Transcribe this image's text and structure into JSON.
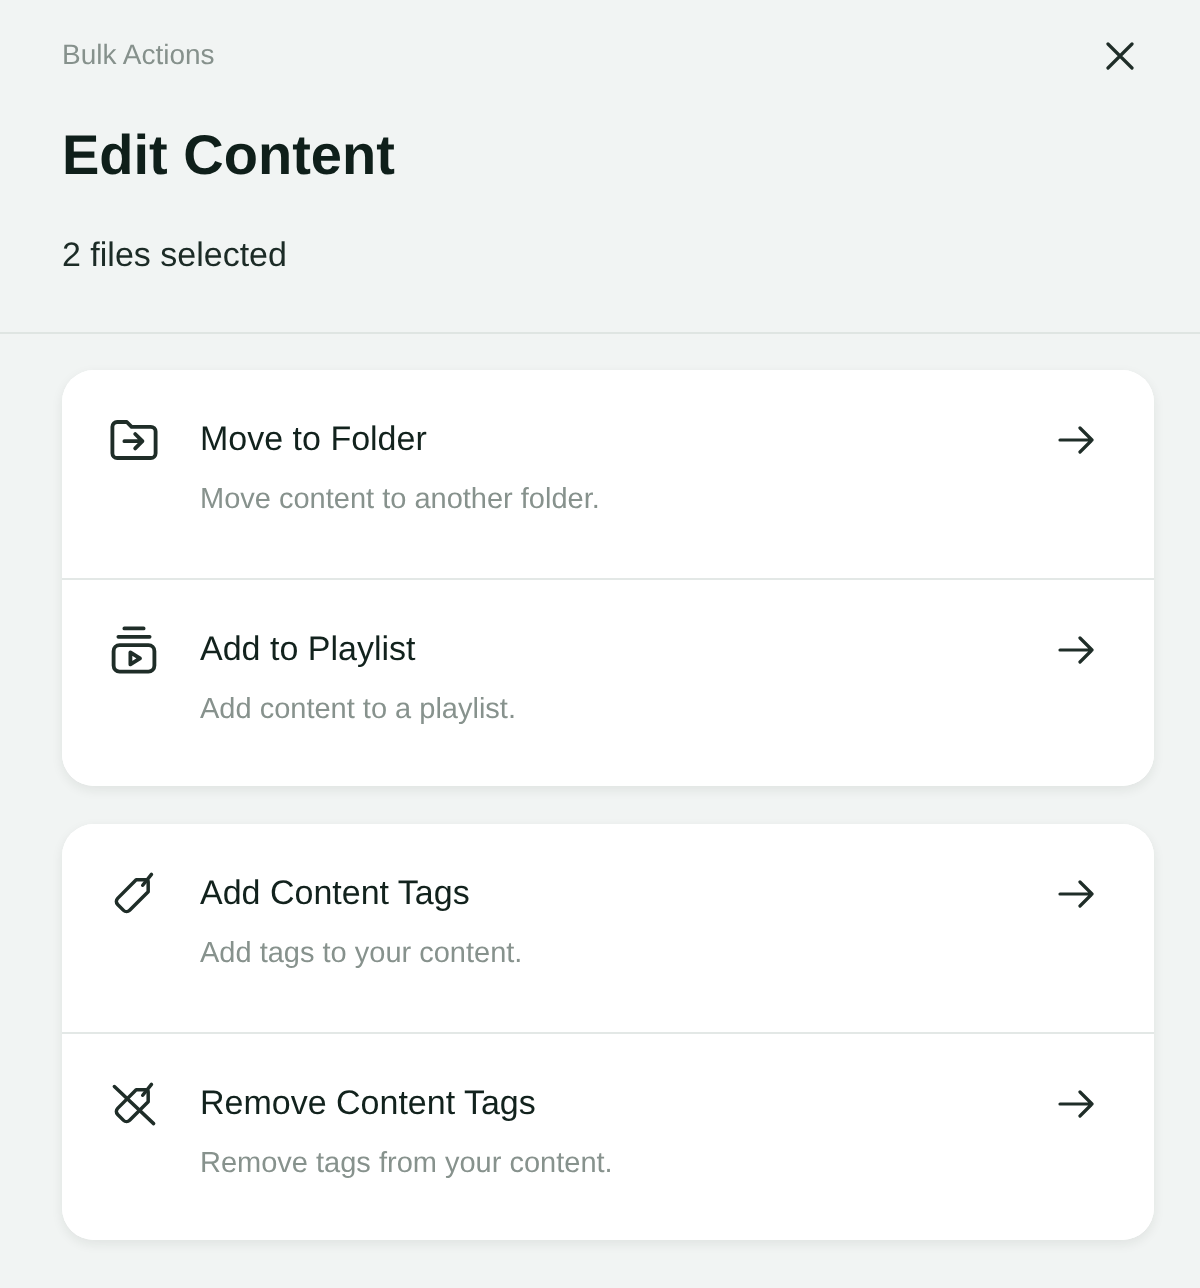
{
  "header": {
    "overline": "Bulk Actions",
    "title": "Edit Content",
    "subtitle": "2 files selected"
  },
  "groups": [
    {
      "actions": [
        {
          "kind": "move",
          "title": "Move to Folder",
          "description": "Move content to another folder."
        },
        {
          "kind": "playlist",
          "title": "Add to Playlist",
          "description": "Add content to a playlist."
        }
      ]
    },
    {
      "actions": [
        {
          "kind": "tag",
          "title": "Add Content Tags",
          "description": "Add tags to your content."
        },
        {
          "kind": "untag",
          "title": "Remove Content Tags",
          "description": "Remove tags from your content."
        }
      ]
    }
  ]
}
